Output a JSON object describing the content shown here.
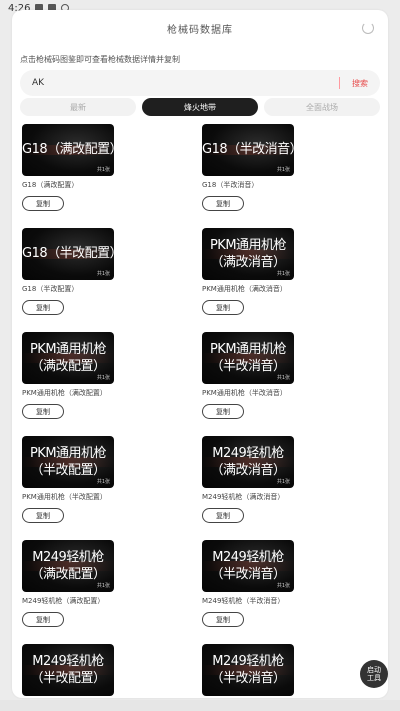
{
  "status_bar": {
    "time": "4:26",
    "icons": [
      "gear-icon",
      "image-icon",
      "circle-icon"
    ]
  },
  "header": {
    "title": "枪械码数据库",
    "refresh_icon": "refresh-icon"
  },
  "tip": "点击枪械码图鉴即可查看枪械数据详情并复制",
  "search": {
    "value": "AK",
    "placeholder": "",
    "button_label": "搜索"
  },
  "tabs": [
    {
      "label": "最新",
      "active": false
    },
    {
      "label": "烽火地带",
      "active": true
    },
    {
      "label": "全面战场",
      "active": false
    }
  ],
  "cards": [
    {
      "thumb_line1": "G18（满改配置）",
      "thumb_line2": "",
      "count": "共1张",
      "caption": "G18（满改配置）",
      "copy_label": "复制"
    },
    {
      "thumb_line1": "G18（半改消音）",
      "thumb_line2": "",
      "count": "共1张",
      "caption": "G18（半改消音）",
      "copy_label": "复制"
    },
    {
      "thumb_line1": "G18（半改配置）",
      "thumb_line2": "",
      "count": "共1张",
      "caption": "G18（半改配置）",
      "copy_label": "复制"
    },
    {
      "thumb_line1": "PKM通用机枪",
      "thumb_line2": "（满改消音）",
      "count": "共1张",
      "caption": "PKM通用机枪（满改消音）",
      "copy_label": "复制"
    },
    {
      "thumb_line1": "PKM通用机枪",
      "thumb_line2": "（满改配置）",
      "count": "共1张",
      "caption": "PKM通用机枪（满改配置）",
      "copy_label": "复制"
    },
    {
      "thumb_line1": "PKM通用机枪",
      "thumb_line2": "（半改消音）",
      "count": "共1张",
      "caption": "PKM通用机枪（半改消音）",
      "copy_label": "复制"
    },
    {
      "thumb_line1": "PKM通用机枪",
      "thumb_line2": "（半改配置）",
      "count": "共1张",
      "caption": "PKM通用机枪（半改配置）",
      "copy_label": "复制"
    },
    {
      "thumb_line1": "M249轻机枪",
      "thumb_line2": "（满改消音）",
      "count": "共1张",
      "caption": "M249轻机枪（满改消音）",
      "copy_label": "复制"
    },
    {
      "thumb_line1": "M249轻机枪",
      "thumb_line2": "（满改配置）",
      "count": "共1张",
      "caption": "M249轻机枪（满改配置）",
      "copy_label": "复制"
    },
    {
      "thumb_line1": "M249轻机枪",
      "thumb_line2": "（半改消音）",
      "count": "共1张",
      "caption": "M249轻机枪（半改消音）",
      "copy_label": "复制"
    },
    {
      "thumb_line1": "M249轻机枪",
      "thumb_line2": "（半改配置）",
      "count": "",
      "caption": "",
      "copy_label": ""
    },
    {
      "thumb_line1": "M249轻机枪",
      "thumb_line2": "（半改消音）",
      "count": "",
      "caption": "",
      "copy_label": ""
    }
  ],
  "fab": {
    "line1": "启动",
    "line2": "工具"
  }
}
